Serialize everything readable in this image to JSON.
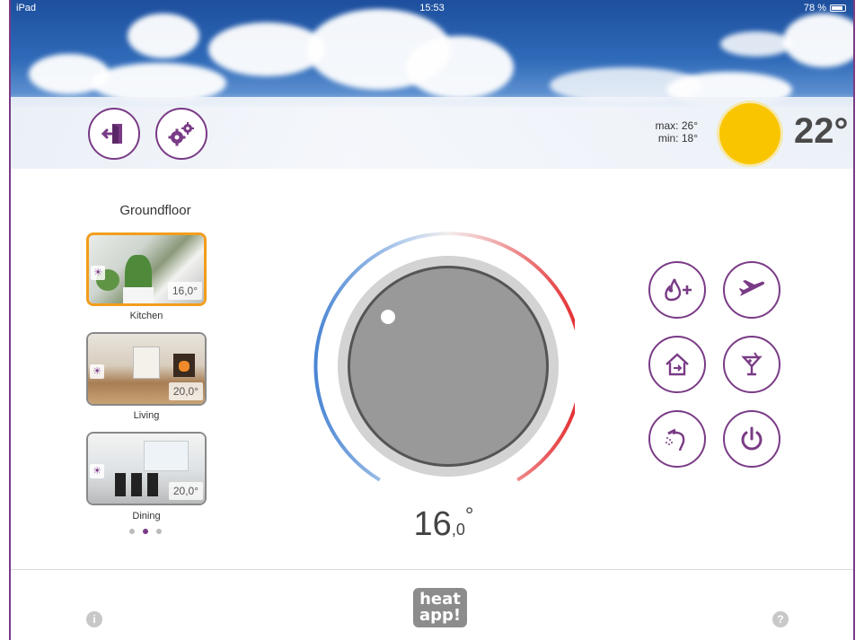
{
  "status": {
    "device": "iPad",
    "time": "15:53",
    "battery": "78 %"
  },
  "weather": {
    "max": "max: 26°",
    "min": "min: 18°",
    "current": "22°"
  },
  "floor": {
    "title": "Groundfloor"
  },
  "rooms": [
    {
      "name": "Kitchen",
      "temp": "16,0°"
    },
    {
      "name": "Living",
      "temp": "20,0°"
    },
    {
      "name": "Dining",
      "temp": "20,0°"
    }
  ],
  "dial": {
    "integer": "16",
    "decimal": ",0",
    "degree": "°"
  },
  "icons": {
    "exit": "exit-door-icon",
    "settings": "gears-icon",
    "boost": "flame-plus-icon",
    "vacation": "airplane-icon",
    "home": "house-icon",
    "party": "cocktail-icon",
    "shower": "shower-icon",
    "power": "power-icon",
    "info": "info-icon",
    "help": "help-icon"
  },
  "logo": {
    "line1": "heat",
    "line2": "app!"
  },
  "help": {
    "info": "i",
    "question": "?"
  },
  "colors": {
    "accent": "#7a3b86",
    "active_room": "#f29d1d",
    "sun": "#f9c500"
  }
}
